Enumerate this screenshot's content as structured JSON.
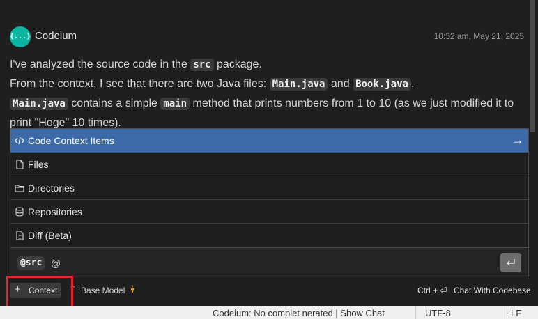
{
  "message": {
    "sender": "Codeium",
    "avatar_text": "{...}",
    "timestamp": "10:32 am, May 21, 2025",
    "line1_pre": "I've analyzed the source code in the ",
    "line1_code": "src",
    "line1_post": " package.",
    "line2_pre": "From the context, I see that there are two Java files: ",
    "line2_code1": "Main.java",
    "line2_mid": " and ",
    "line2_code2": "Book.java",
    "line2_post": ".",
    "line3_code1": "Main.java",
    "line3_mid": " contains a simple ",
    "line3_code2": "main",
    "line3_post": " method that prints numbers from 1 to 10 (as we just modified it to print \"Hoge\" 10 times)."
  },
  "context_menu": {
    "items": [
      {
        "label": "Code Context Items",
        "icon": "code-icon",
        "active": true
      },
      {
        "label": "Files",
        "icon": "file-icon"
      },
      {
        "label": "Directories",
        "icon": "folder-icon"
      },
      {
        "label": "Repositories",
        "icon": "database-icon"
      },
      {
        "label": "Diff (Beta)",
        "icon": "diff-icon"
      }
    ],
    "arrow": "→"
  },
  "input": {
    "mention": "@src",
    "typed": "@",
    "send_icon": "enter-icon"
  },
  "toolbar": {
    "context_plus": "+",
    "context_label": "Context",
    "model_chevron": "^",
    "model_label": "Base Model",
    "shortcut": "Ctrl + ⏎",
    "chat_codebase": "Chat With Codebase"
  },
  "statusbar": {
    "main": "Codeium: No complet  nerated | Show Chat",
    "encoding": "UTF-8",
    "eol": "LF"
  },
  "colors": {
    "accent": "#3d6aa8",
    "avatar": "#09b6a2",
    "highlight": "#e3262d",
    "bolt": "#e8a33c"
  }
}
